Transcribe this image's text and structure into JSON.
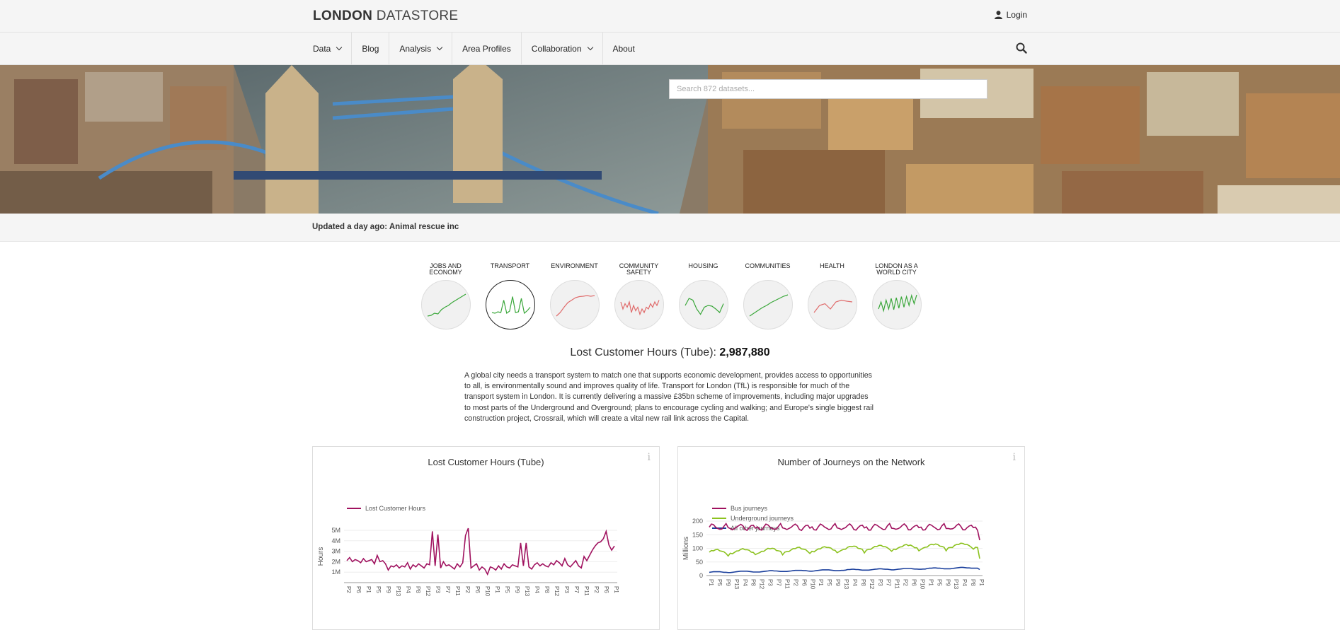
{
  "header": {
    "logo_bold": "LONDON",
    "logo_light": "DATASTORE",
    "login_label": "Login"
  },
  "nav": {
    "items": [
      {
        "label": "Data",
        "dropdown": true
      },
      {
        "label": "Blog",
        "dropdown": false
      },
      {
        "label": "Analysis",
        "dropdown": true
      },
      {
        "label": "Area Profiles",
        "dropdown": false
      },
      {
        "label": "Collaboration",
        "dropdown": true
      },
      {
        "label": "About",
        "dropdown": false
      }
    ]
  },
  "search": {
    "placeholder": "Search 872 datasets..."
  },
  "updated": {
    "text": "Updated a day ago: Animal rescue inc"
  },
  "themes": [
    {
      "label": "Jobs and Economy",
      "color": "#3aa73a",
      "active": false
    },
    {
      "label": "Transport",
      "color": "#3aa73a",
      "active": true
    },
    {
      "label": "Environment",
      "color": "#e06b6b",
      "active": false
    },
    {
      "label": "Community Safety",
      "color": "#e06b6b",
      "active": false
    },
    {
      "label": "Housing",
      "color": "#3aa73a",
      "active": false
    },
    {
      "label": "Communities",
      "color": "#3aa73a",
      "active": false
    },
    {
      "label": "Health",
      "color": "#e06b6b",
      "active": false
    },
    {
      "label": "London as a World City",
      "color": "#3aa73a",
      "active": false
    }
  ],
  "metric": {
    "label": "Lost Customer Hours (Tube):",
    "value": "2,987,880"
  },
  "description": "A global city needs a transport system to match one that supports economic development, provides access to opportunities to all, is environmentally sound and improves quality of life. Transport for London (TfL) is responsible for much of the transport system in London. It is currently delivering a massive £35bn scheme of improvements, including major upgrades to most parts of the Underground and Overground; plans to encourage cycling and walking; and Europe's single biggest rail construction project, Crossrail, which will create a vital new rail link across the Capital.",
  "chart_data": [
    {
      "type": "line",
      "title": "Lost Customer Hours (Tube)",
      "ylabel": "Hours",
      "ylim": [
        0,
        5000000
      ],
      "yticks": [
        "1M",
        "2M",
        "3M",
        "4M",
        "5M"
      ],
      "x_tick_labels": [
        "P2",
        "P6",
        "P1",
        "P5",
        "P9",
        "P13",
        "P4",
        "P8",
        "P12",
        "P3",
        "P7",
        "P11",
        "P2",
        "P6",
        "P10",
        "P1",
        "P5",
        "P9",
        "P13",
        "P4",
        "P8",
        "P12",
        "P3",
        "P7",
        "P11",
        "P2",
        "P6",
        "P1"
      ],
      "series": [
        {
          "name": "Lost Customer Hours",
          "color": "#a0125f",
          "values": [
            2100000,
            2400000,
            2000000,
            2200000,
            2100000,
            1900000,
            2300000,
            2000000,
            2100000,
            2200000,
            1800000,
            2600000,
            2000000,
            2100000,
            1800000,
            1200000,
            1600000,
            1500000,
            1700000,
            1400000,
            1600000,
            1500000,
            1900000,
            1300000,
            1700000,
            1500000,
            1800000,
            1600000,
            1400000,
            1800000,
            1700000,
            4900000,
            1600000,
            4600000,
            1400000,
            2000000,
            1600000,
            1700000,
            1500000,
            1300000,
            1800000,
            1500000,
            1900000,
            4500000,
            5200000,
            1400000,
            1600000,
            1800000,
            1200000,
            1500000,
            1300000,
            800000,
            1500000,
            1400000,
            1200000,
            1600000,
            1300000,
            1800000,
            1500000,
            1400000,
            1700000,
            1600000,
            1500000,
            3800000,
            1600000,
            3800000,
            1500000,
            1300000,
            1700000,
            1900000,
            1600000,
            1800000,
            1600000,
            1500000,
            1900000,
            1700000,
            2100000,
            1900000,
            1600000,
            2300000,
            1700000,
            1500000,
            1800000,
            2100000,
            1600000,
            1400000,
            2500000,
            2100000,
            2600000,
            3100000,
            3500000,
            3800000,
            3900000,
            4200000,
            4900000,
            3600000,
            3100000,
            3500000
          ]
        }
      ]
    },
    {
      "type": "line",
      "title": "Number of Journeys on the Network",
      "ylabel": "Millions",
      "ylim": [
        0,
        200
      ],
      "yticks": [
        "0",
        "50",
        "100",
        "150",
        "200"
      ],
      "x_tick_labels": [
        "P1",
        "P5",
        "P9",
        "P13",
        "P4",
        "P8",
        "P12",
        "P3",
        "P7",
        "P11",
        "P2",
        "P6",
        "P10",
        "P1",
        "P5",
        "P9",
        "P13",
        "P4",
        "P8",
        "P12",
        "P3",
        "P7",
        "P11",
        "P2",
        "P6",
        "P10",
        "P1",
        "P5",
        "P9",
        "P13",
        "P4",
        "P8",
        "P1"
      ],
      "series": [
        {
          "name": "Bus journeys",
          "color": "#a0125f",
          "values": []
        },
        {
          "name": "Underground journeys",
          "color": "#8cc21f",
          "values": []
        },
        {
          "name": "All other journeys",
          "color": "#1a3f9c",
          "values": []
        }
      ]
    }
  ]
}
